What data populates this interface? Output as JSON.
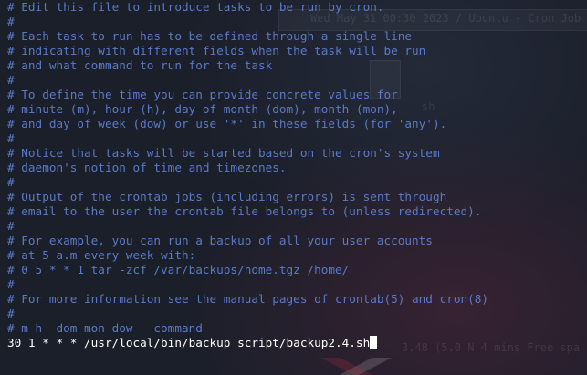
{
  "background_ghost_text": {
    "top": "Wed May 31 00:30 2023 / Ubuntu - Cron Job YouTube",
    "mid": "sh",
    "bottom": "3.48 (5.0 N 4 mins Free spa"
  },
  "file_lines": [
    "# Edit this file to introduce tasks to be run by cron.",
    "#",
    "# Each task to run has to be defined through a single line",
    "# indicating with different fields when the task will be run",
    "# and what command to run for the task",
    "#",
    "# To define the time you can provide concrete values for",
    "# minute (m), hour (h), day of month (dom), month (mon),",
    "# and day of week (dow) or use '*' in these fields (for 'any').",
    "#",
    "# Notice that tasks will be started based on the cron's system",
    "# daemon's notion of time and timezones.",
    "#",
    "# Output of the crontab jobs (including errors) is sent through",
    "# email to the user the crontab file belongs to (unless redirected).",
    "#",
    "# For example, you can run a backup of all your user accounts",
    "# at 5 a.m every week with:",
    "# 0 5 * * 1 tar -zcf /var/backups/home.tgz /home/",
    "#",
    "# For more information see the manual pages of crontab(5) and cron(8)",
    "#",
    "# m h  dom mon dow   command"
  ],
  "command_line": "30 1 * * * /usr/local/bin/backup_script/backup2.4.sh",
  "colors": {
    "comment": "#5a79c8",
    "command": "#ffffff",
    "background": "#1b1f2a"
  }
}
